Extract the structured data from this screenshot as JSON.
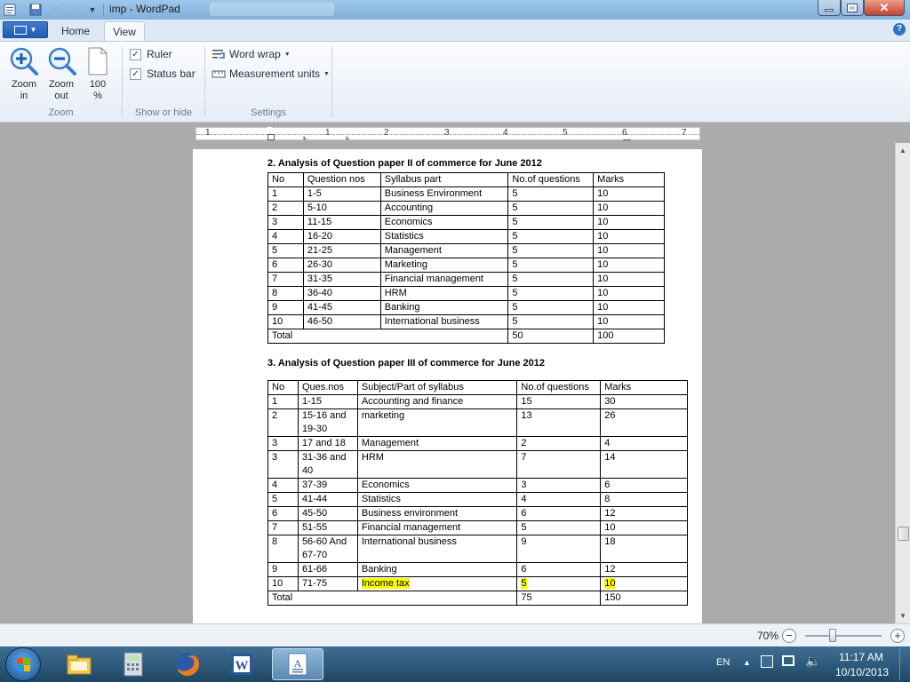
{
  "window": {
    "title": "imp - WordPad",
    "background_doc_title": "Question paper II of commerce for June 2012"
  },
  "ribbon": {
    "app_menu_icon": "document-menu-icon",
    "tabs": [
      {
        "label": "Home",
        "active": false
      },
      {
        "label": "View",
        "active": true
      }
    ],
    "groups": {
      "zoom": {
        "label": "Zoom",
        "zoom_in": "Zoom\nin",
        "zoom_out": "Zoom\nout",
        "zoom_100": "100\n%"
      },
      "show_hide": {
        "label": "Show or hide",
        "ruler": {
          "label": "Ruler",
          "checked": true
        },
        "status_bar": {
          "label": "Status bar",
          "checked": true
        }
      },
      "settings": {
        "label": "Settings",
        "word_wrap": "Word wrap",
        "measurement_units": "Measurement units"
      }
    }
  },
  "ruler": {
    "numbers": [
      "1",
      "1",
      "2",
      "3",
      "4",
      "5",
      "6",
      "7"
    ]
  },
  "document": {
    "section2": {
      "heading": "2. Analysis of Question paper II of commerce for June 2012",
      "headers": [
        "No",
        "Question nos",
        "Syllabus part",
        "No.of questions",
        "Marks"
      ],
      "rows": [
        [
          "1",
          "1-5",
          "Business Environment",
          "5",
          "10"
        ],
        [
          "2",
          "5-10",
          "Accounting",
          "5",
          "10"
        ],
        [
          "3",
          "11-15",
          "Economics",
          "5",
          "10"
        ],
        [
          "4",
          "16-20",
          "Statistics",
          "5",
          "10"
        ],
        [
          "5",
          "21-25",
          "Management",
          "5",
          "10"
        ],
        [
          "6",
          "26-30",
          "Marketing",
          "5",
          "10"
        ],
        [
          "7",
          "31-35",
          "Financial management",
          "5",
          "10"
        ],
        [
          "8",
          "36-40",
          "HRM",
          "5",
          "10"
        ],
        [
          "9",
          "41-45",
          "Banking",
          "5",
          "10"
        ],
        [
          "10",
          "46-50",
          "International business",
          "5",
          "10"
        ]
      ],
      "total": {
        "label": "Total",
        "questions": "50",
        "marks": "100"
      }
    },
    "section3": {
      "heading": "3. Analysis of Question paper III of commerce for June 2012",
      "headers": [
        "No",
        "Ques.nos",
        "Subject/Part of syllabus",
        "No.of questions",
        "Marks"
      ],
      "rows": [
        [
          "1",
          "1-15",
          "Accounting and finance",
          "15",
          "30"
        ],
        [
          "2",
          "15-16 and 19-30",
          "marketing",
          "13",
          "26"
        ],
        [
          "3",
          "17 and 18",
          "Management",
          "2",
          "4"
        ],
        [
          "3",
          "31-36 and 40",
          "HRM",
          "7",
          "14"
        ],
        [
          "4",
          "37-39",
          "Economics",
          "3",
          "6"
        ],
        [
          "5",
          "41-44",
          "Statistics",
          "4",
          "8"
        ],
        [
          "6",
          "45-50",
          "Business environment",
          "6",
          "12"
        ],
        [
          "7",
          "51-55",
          "Financial management",
          "5",
          "10"
        ],
        [
          "8",
          "56-60 And 67-70",
          "International business",
          "9",
          "18"
        ],
        [
          "9",
          "61-66",
          "Banking",
          "6",
          "12"
        ],
        [
          "10",
          "71-75",
          "Income tax",
          "5",
          "10"
        ]
      ],
      "total": {
        "label": "Total",
        "questions": "75",
        "marks": "150"
      }
    }
  },
  "statusbar": {
    "zoom": "70%"
  },
  "taskbar": {
    "language": "EN",
    "time": "11:17 AM",
    "date": "10/10/2013",
    "apps": [
      "explorer-icon",
      "calculator-icon",
      "firefox-icon",
      "word-icon",
      "wordpad-icon"
    ]
  },
  "colors": {
    "highlight": "#ffff00",
    "title_bar": "#9fc7ea",
    "taskbar": "#1f4664"
  }
}
